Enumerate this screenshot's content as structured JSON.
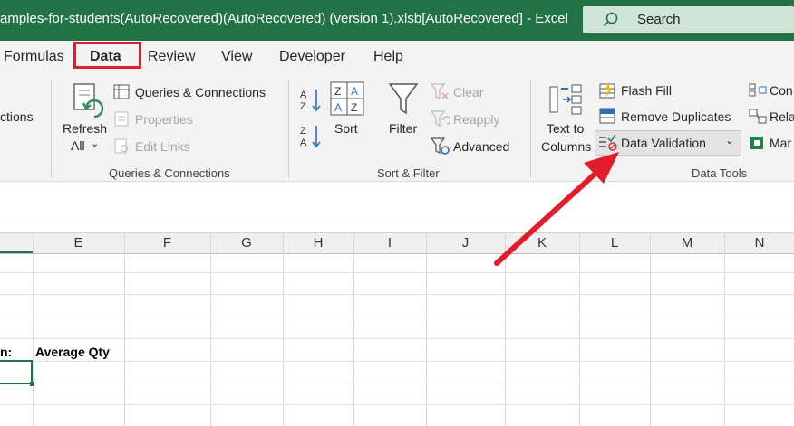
{
  "titlebar": {
    "title": "amples-for-students(AutoRecovered)(AutoRecovered) (version 1).xlsb[AutoRecovered]  -  Excel",
    "search_label": "Search"
  },
  "tabs": [
    "Formulas",
    "Data",
    "Review",
    "View",
    "Developer",
    "Help"
  ],
  "ribbon": {
    "left_partial": "ctions",
    "get_data": {
      "refresh_line1": "Refresh",
      "refresh_line2": "All",
      "queries_connections": "Queries & Connections",
      "properties": "Properties",
      "edit_links": "Edit Links",
      "group_label": "Queries & Connections"
    },
    "sort_filter": {
      "sort": "Sort",
      "filter": "Filter",
      "clear": "Clear",
      "reapply": "Reapply",
      "advanced": "Advanced",
      "group_label": "Sort & Filter"
    },
    "data_tools": {
      "text_to_line1": "Text to",
      "text_to_line2": "Columns",
      "flash_fill": "Flash Fill",
      "remove_duplicates": "Remove Duplicates",
      "data_validation": "Data Validation",
      "cons": "Con",
      "rela": "Rela",
      "mar": "Mar",
      "group_label": "Data Tools"
    }
  },
  "columns": [
    "E",
    "F",
    "G",
    "H",
    "I",
    "J",
    "K",
    "L",
    "M",
    "N"
  ],
  "cells": {
    "partial_label": "n:",
    "average_qty": "Average Qty"
  },
  "colors": {
    "excel_green": "#217346",
    "highlight_red": "#e21c2a"
  }
}
